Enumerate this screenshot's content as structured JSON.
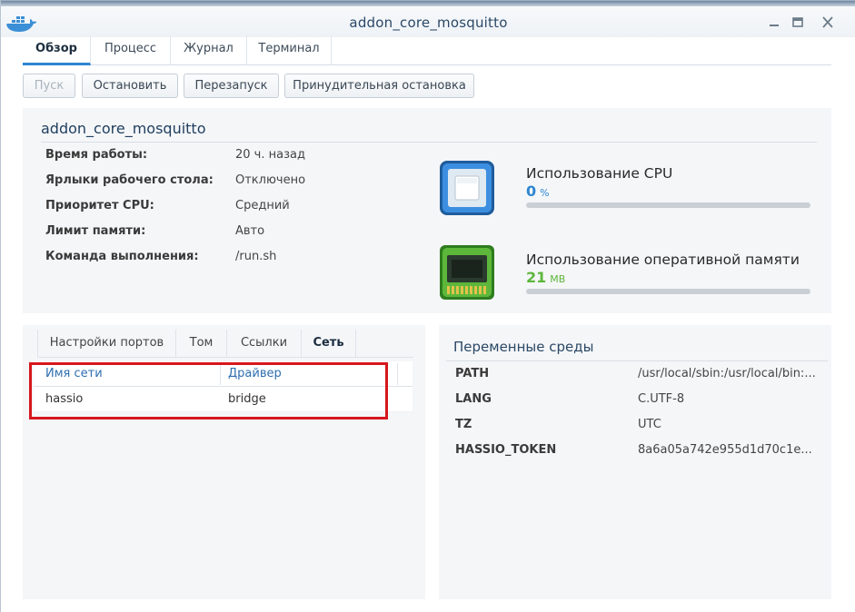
{
  "window": {
    "title": "addon_core_mosquitto"
  },
  "tabs": [
    {
      "label": "Обзор"
    },
    {
      "label": "Процесс"
    },
    {
      "label": "Журнал"
    },
    {
      "label": "Терминал"
    }
  ],
  "actions": {
    "start": "Пуск",
    "stop": "Остановить",
    "restart": "Перезапуск",
    "force_stop": "Принудительная остановка"
  },
  "overview": {
    "container_name": "addon_core_mosquitto",
    "rows": [
      {
        "label": "Время работы:",
        "value": "20 ч. назад"
      },
      {
        "label": "Ярлыки рабочего стола:",
        "value": "Отключено"
      },
      {
        "label": "Приоритет CPU:",
        "value": "Средний"
      },
      {
        "label": "Лимит памяти:",
        "value": "Авто"
      },
      {
        "label": "Команда выполнения:",
        "value": "/run.sh"
      }
    ]
  },
  "cpu": {
    "title": "Использование CPU",
    "value": "0",
    "unit": "%",
    "percent": 0,
    "color": "#2d86d1",
    "icon": "cpu-chip-icon"
  },
  "ram": {
    "title": "Использование оперативной памяти",
    "value": "21",
    "unit": "MB",
    "percent": 0,
    "color": "#5db73b",
    "icon": "ram-module-icon"
  },
  "subtabs": [
    {
      "label": "Настройки портов"
    },
    {
      "label": "Том"
    },
    {
      "label": "Ссылки"
    },
    {
      "label": "Сеть"
    }
  ],
  "network": {
    "columns": {
      "name": "Имя сети",
      "driver": "Драйвер"
    },
    "rows": [
      {
        "name": "hassio",
        "driver": "bridge"
      }
    ]
  },
  "env": {
    "title": "Переменные среды",
    "rows": [
      {
        "key": "PATH",
        "value": "/usr/local/sbin:/usr/local/bin:..."
      },
      {
        "key": "LANG",
        "value": "C.UTF-8"
      },
      {
        "key": "TZ",
        "value": "UTC"
      },
      {
        "key": "HASSIO_TOKEN",
        "value": "8a6a05a742e955d1d70c1e..."
      }
    ]
  },
  "colors": {
    "accent": "#2d86d1",
    "highlight": "#d6171c"
  }
}
